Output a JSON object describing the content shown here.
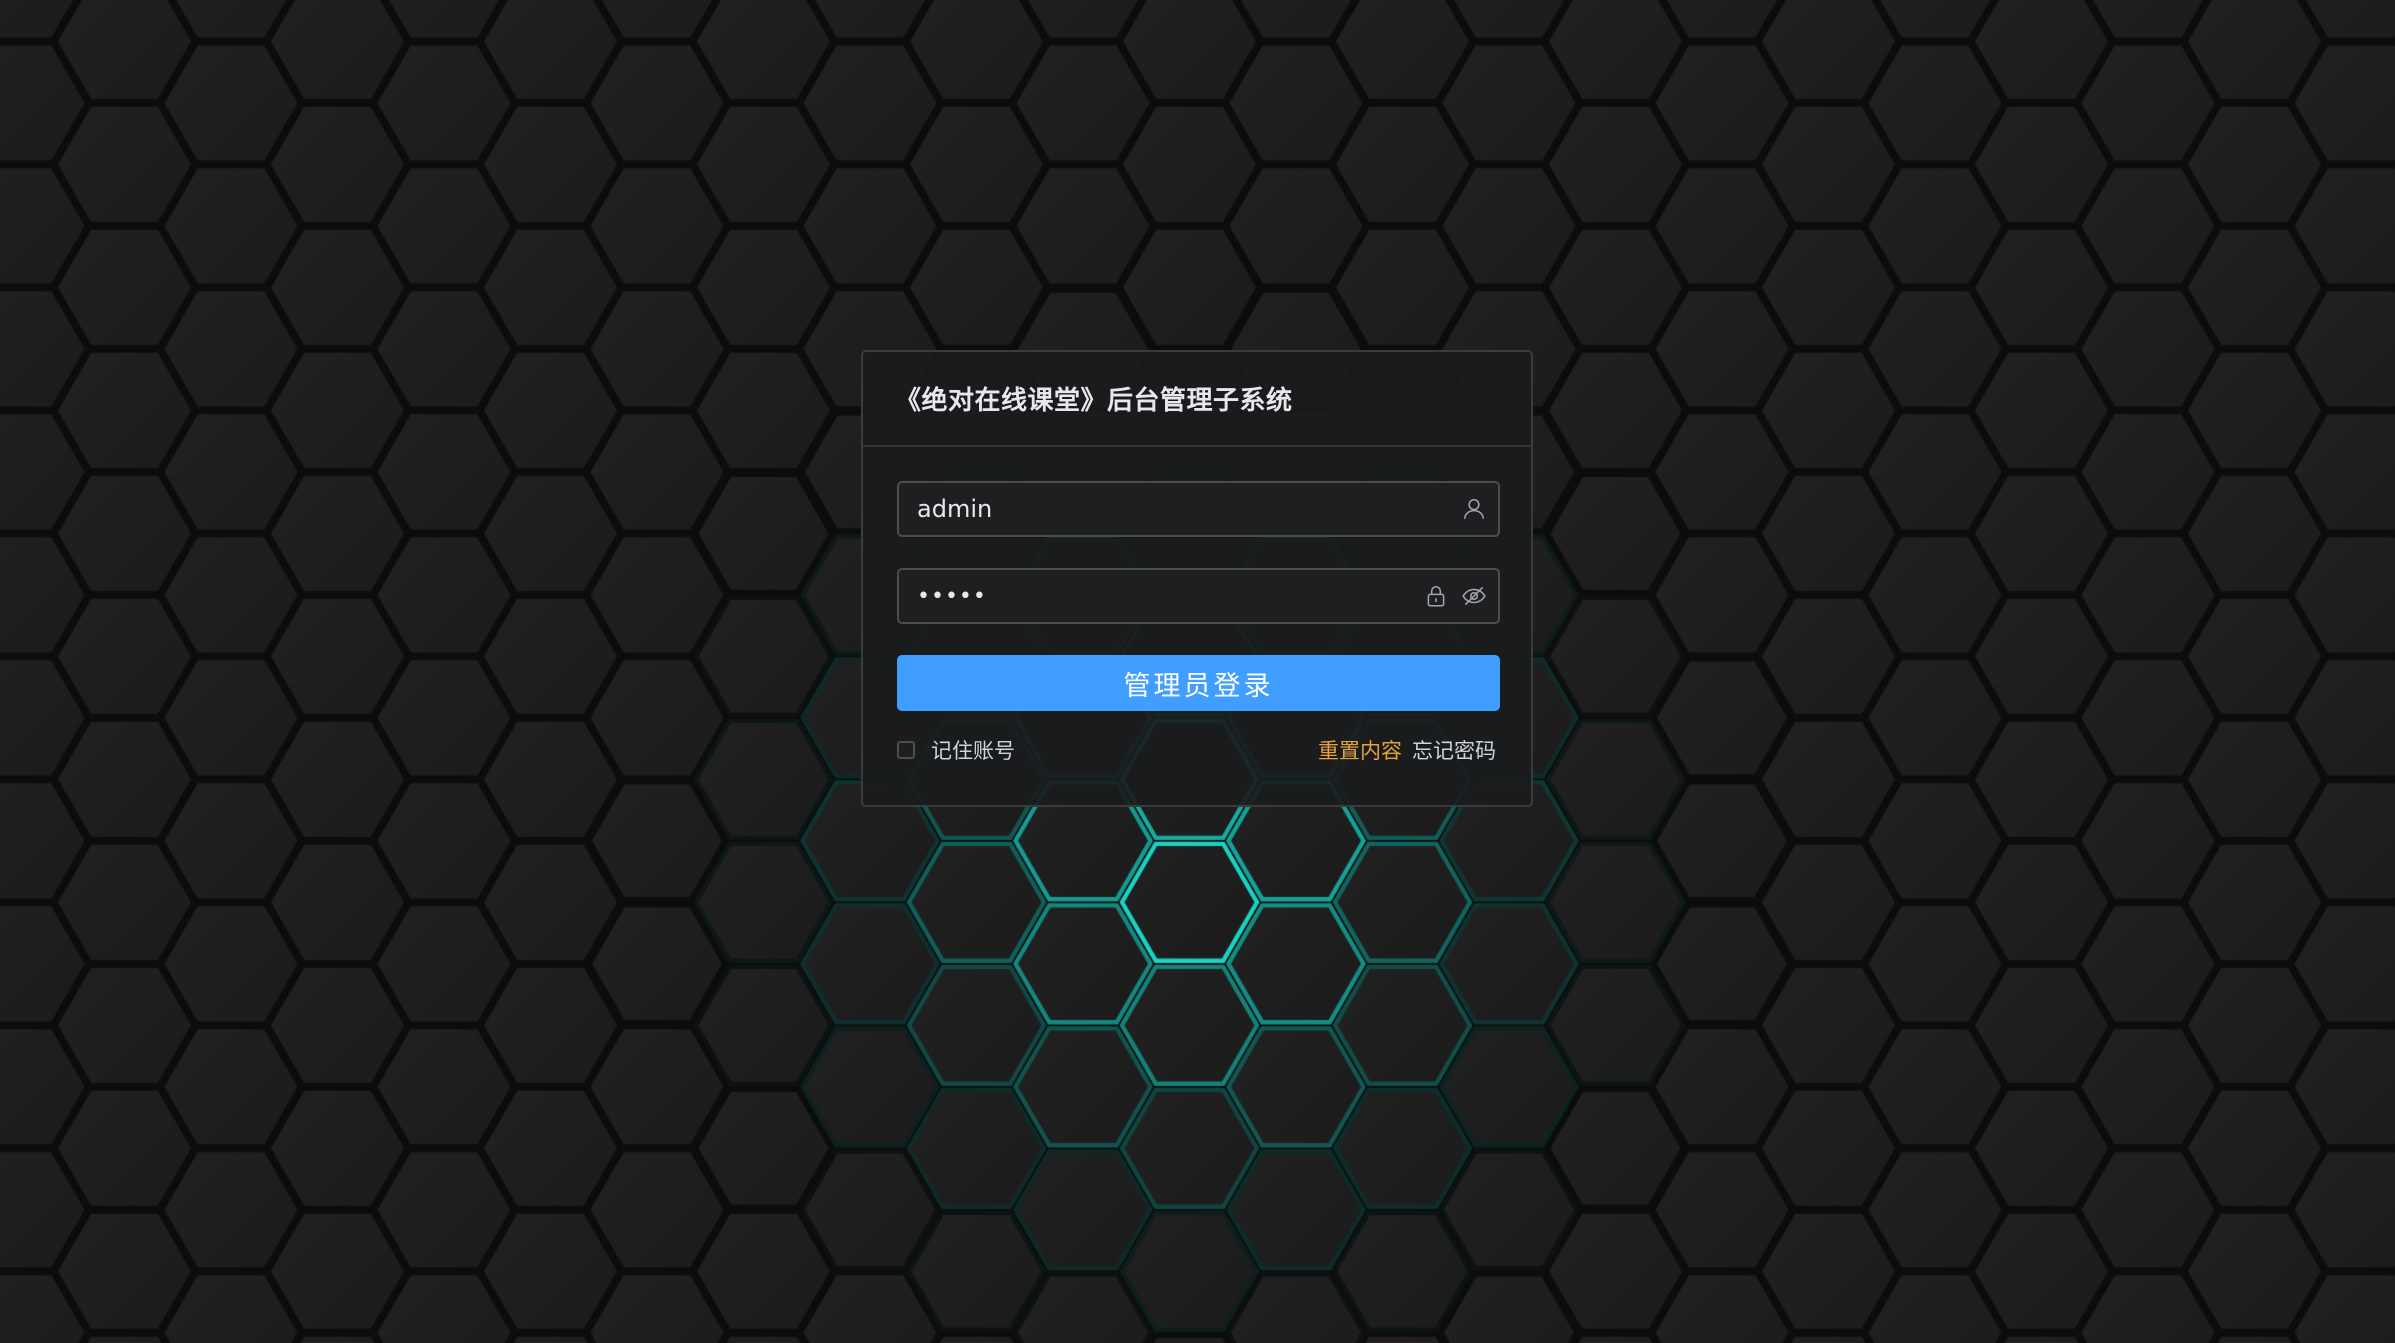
{
  "background": {
    "base_color": "#1b1b1b",
    "glow_color": "#19d3c5"
  },
  "login": {
    "title": "《绝对在线课堂》后台管理子系统",
    "username": {
      "value": "admin",
      "icon": "user-icon"
    },
    "password": {
      "value": "•••••",
      "lock_icon": "lock-icon",
      "toggle_icon": "eye-hidden-icon"
    },
    "submit_label": "管理员登录",
    "remember_label": "记住账号",
    "remember_checked": false,
    "reset_label": "重置内容",
    "forgot_label": "忘记密码",
    "colors": {
      "primary": "#409eff",
      "warning": "#e6a23c"
    }
  }
}
